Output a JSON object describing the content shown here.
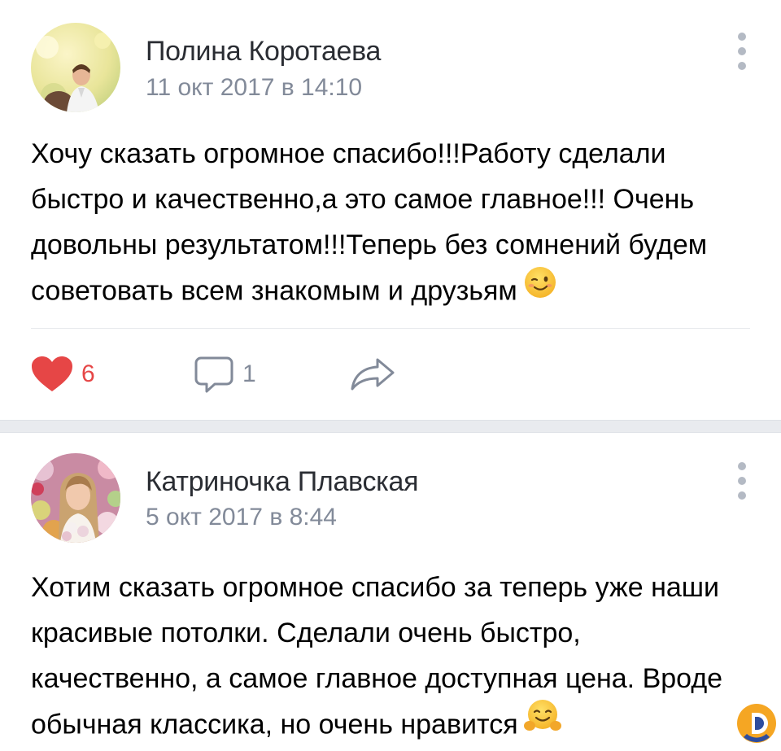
{
  "posts": [
    {
      "author": "Полина Коротаева",
      "date": "11 окт 2017 в 14:10",
      "text": "Хочу сказать огромное спасибо!!!Работу сделали быстро и качественно,а это самое главное!!! Очень довольны результатом!!!Теперь без сомнений будем советовать всем знакомым и друзьям",
      "emoji": "winking-face",
      "likes": "6",
      "comments": "1"
    },
    {
      "author": "Катриночка Плавская",
      "date": "5 окт 2017 в 8:44",
      "text": "Хотим сказать огромное спасибо за теперь уже наши красивые потолки. Сделали очень быстро, качественно, а самое главное доступная цена. Вроде обычная классика, но очень нравится",
      "emoji": "hugging-face"
    }
  ],
  "colors": {
    "like": "#e64646",
    "secondary_text": "#828a99",
    "separator": "#e9ebef",
    "logo_orange": "#f5a623",
    "logo_blue": "#2e4d9e"
  },
  "icons": [
    "more-vertical-icon",
    "heart-icon",
    "comment-icon",
    "share-icon",
    "app-logo"
  ]
}
